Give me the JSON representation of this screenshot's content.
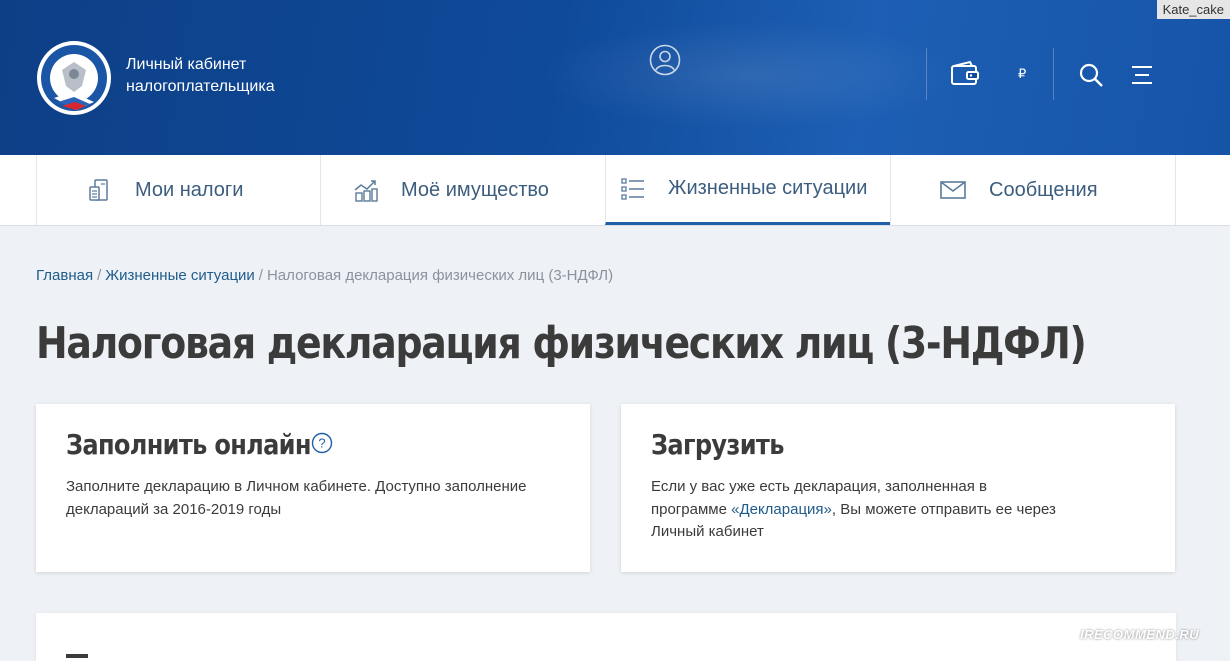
{
  "header": {
    "brand_line1": "Личный кабинет",
    "brand_line2": "налогоплательщика",
    "balance": "₽",
    "watermark_user": "Kate_cake"
  },
  "nav": {
    "tabs": [
      {
        "label": "Мои налоги",
        "icon": "calculator-documents-icon",
        "active": false
      },
      {
        "label": "Моё имущество",
        "icon": "property-chart-icon",
        "active": false
      },
      {
        "label": "Жизненные ситуации",
        "icon": "list-icon",
        "active": true
      },
      {
        "label": "Сообщения",
        "icon": "envelope-icon",
        "active": false
      }
    ]
  },
  "breadcrumbs": {
    "home": "Главная",
    "section": "Жизненные ситуации",
    "current": "Налоговая декларация физических лиц (3-НДФЛ)"
  },
  "page": {
    "title": "Налоговая декларация физических лиц (3-НДФЛ)"
  },
  "cards": {
    "online": {
      "title": "Заполнить онлайн",
      "line1": "Заполните декларацию в Личном кабинете. Доступно заполнение",
      "line2": "деклараций за 2016-2019 годы"
    },
    "upload": {
      "title": "Загрузить",
      "line1": "Если у вас уже есть декларация, заполненная в",
      "line2_before": "программе ",
      "line2_link": "«Декларация»",
      "line2_after": ", Вы можете отправить ее через",
      "line3": "Личный кабинет"
    }
  },
  "watermark": "IRECOMMEND.RU",
  "colors": {
    "header_blue": "#0f4a9a",
    "nav_text": "#3d5d7e",
    "link": "#1f5c8c",
    "active_underline": "#1f5fa8"
  }
}
